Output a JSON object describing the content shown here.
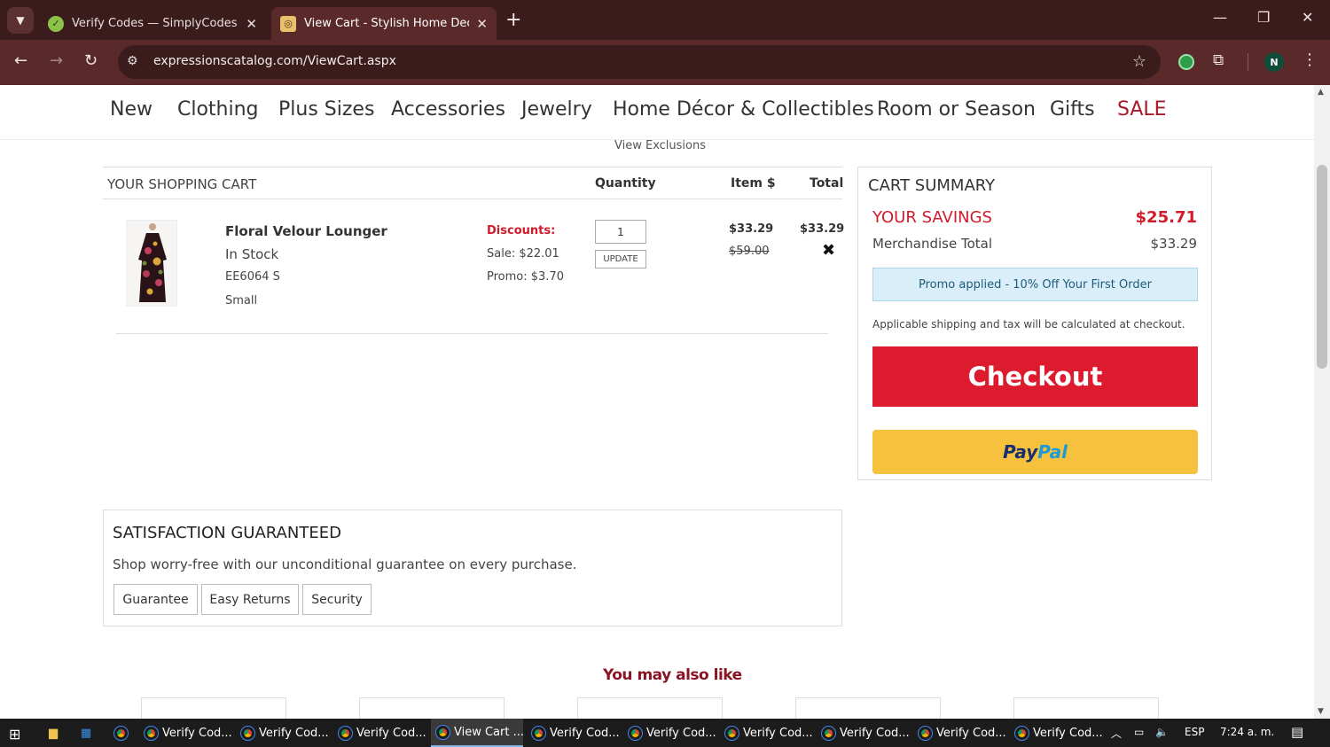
{
  "browser": {
    "tabs": [
      {
        "title": "Verify Codes — SimplyCodes",
        "active": false
      },
      {
        "title": "View Cart - Stylish Home Decor",
        "active": true
      }
    ],
    "url": "expressionscatalog.com/ViewCart.aspx",
    "profile_initial": "N"
  },
  "nav": {
    "items": [
      "New",
      "Clothing",
      "Plus Sizes",
      "Accessories",
      "Jewelry",
      "Home Décor & Collectibles",
      "Room or Season",
      "Gifts"
    ],
    "sale": "SALE"
  },
  "view_exclusions": "View Exclusions",
  "cart": {
    "title": "YOUR SHOPPING CART",
    "col_quantity": "Quantity",
    "col_item": "Item $",
    "col_total": "Total",
    "item": {
      "name": "Floral Velour Lounger",
      "stock": "In Stock",
      "sku": "EE6064 S",
      "size": "Small",
      "discounts_label": "Discounts:",
      "sale": "Sale: $22.01",
      "promo": "Promo: $3.70",
      "quantity": "1",
      "update_label": "UPDATE",
      "item_price": "$33.29",
      "original_price": "$59.00",
      "total": "$33.29"
    }
  },
  "summary": {
    "title": "CART SUMMARY",
    "savings_label": "YOUR SAVINGS",
    "savings_value": "$25.71",
    "merch_label": "Merchandise Total",
    "merch_value": "$33.29",
    "promo_text": "Promo applied - 10% Off Your First Order",
    "shipping_note": "Applicable shipping and tax will be calculated at checkout.",
    "checkout_label": "Checkout",
    "paypal_a": "Pay",
    "paypal_b": "Pal"
  },
  "guarantee": {
    "title": "SATISFACTION GUARANTEED",
    "text": "Shop worry-free with our unconditional guarantee on every purchase.",
    "tabs": [
      "Guarantee",
      "Easy Returns",
      "Security"
    ]
  },
  "recommend_title": "You may also like",
  "taskbar": {
    "tasks": [
      "Verify Cod...",
      "Verify Cod...",
      "Verify Cod...",
      "View Cart ...",
      "Verify Cod...",
      "Verify Cod...",
      "Verify Cod...",
      "Verify Cod...",
      "Verify Cod...",
      "Verify Cod..."
    ],
    "lang": "ESP",
    "time": "7:24 a. m."
  },
  "colors": {
    "brand_red": "#dc1c2e",
    "sale_red": "#a8182b",
    "chrome_bg": "#5a2a2a",
    "paypal_yellow": "#f6c23e"
  }
}
